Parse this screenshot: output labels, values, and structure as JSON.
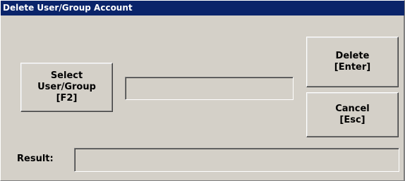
{
  "window": {
    "title": "Delete User/Group Account"
  },
  "select_button": {
    "line1": "Select",
    "line2": "User/Group",
    "line3": "[F2]"
  },
  "selected_field": {
    "value": ""
  },
  "delete_button": {
    "line1": "Delete",
    "line2": "[Enter]"
  },
  "cancel_button": {
    "line1": "Cancel",
    "line2": "[Esc]"
  },
  "result": {
    "label": "Result:",
    "value": ""
  },
  "colors": {
    "titlebar": "#0a246a",
    "face": "#d4d0c8"
  }
}
